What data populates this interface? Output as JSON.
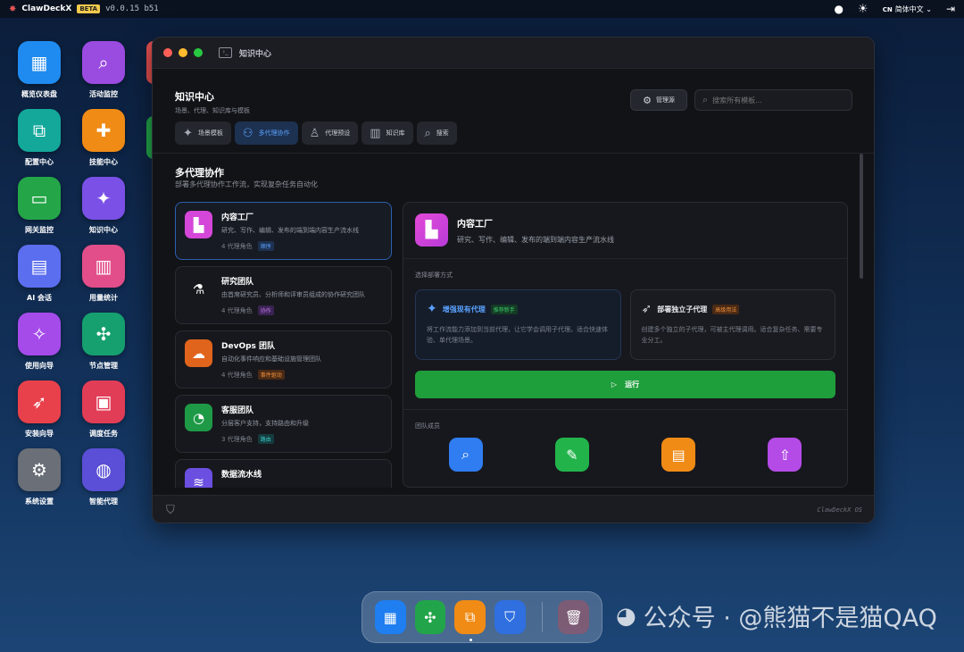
{
  "topbar": {
    "app_name": "ClawDeckX",
    "beta": "BETA",
    "version": "v0.0.15 b51",
    "lang_code": "CN",
    "lang_name": "简体中文"
  },
  "desktop_icons": [
    {
      "label": "概览仪表盘",
      "icon": "dashboard-icon",
      "color": "#1f8bf0",
      "glyph": "▦"
    },
    {
      "label": "活动监控",
      "icon": "activity-icon",
      "color": "#9a4be0",
      "glyph": "⌕"
    },
    {
      "label": "配置中心",
      "icon": "config-icon",
      "color": "#13a89a",
      "glyph": "⧉"
    },
    {
      "label": "技能中心",
      "icon": "puzzle-icon",
      "color": "#f08b16",
      "glyph": "✚"
    },
    {
      "label": "网关监控",
      "icon": "router-icon",
      "color": "#24a648",
      "glyph": "▭"
    },
    {
      "label": "知识中心",
      "icon": "sparkles-icon",
      "color": "#7b50e6",
      "glyph": "✦"
    },
    {
      "label": "AI 会话",
      "icon": "chat-icon",
      "color": "#5b6ef0",
      "glyph": "▤"
    },
    {
      "label": "用量统计",
      "icon": "stats-icon",
      "color": "#e24e8a",
      "glyph": "▥"
    },
    {
      "label": "使用向导",
      "icon": "wand-icon",
      "color": "#a44bea",
      "glyph": "✧"
    },
    {
      "label": "节点管理",
      "icon": "nodes-icon",
      "color": "#16a070",
      "glyph": "✣"
    },
    {
      "label": "安装向导",
      "icon": "rocket-icon",
      "color": "#e9414b",
      "glyph": "➶"
    },
    {
      "label": "调度任务",
      "icon": "calendar-icon",
      "color": "#e23d57",
      "glyph": "▣"
    },
    {
      "label": "系统设置",
      "icon": "gear-icon",
      "color": "#6a6f78",
      "glyph": "⚙"
    },
    {
      "label": "智能代理",
      "icon": "robot-icon",
      "color": "#5a4fd6",
      "glyph": "◍"
    }
  ],
  "window": {
    "title": "知识中心",
    "header_title": "知识中心",
    "header_sub": "场景、代理、知识库与模板",
    "manage_label": "管理源",
    "search_placeholder": "搜索所有模板...",
    "tabs": [
      {
        "label": "场景模板",
        "icon": "sparkles-icon",
        "glyph": "✦"
      },
      {
        "label": "多代理协作",
        "icon": "users-icon",
        "glyph": "⚇"
      },
      {
        "label": "代理预设",
        "icon": "user-icon",
        "glyph": "♙"
      },
      {
        "label": "知识库",
        "icon": "book-icon",
        "glyph": "▥"
      },
      {
        "label": "搜索",
        "icon": "search-icon",
        "glyph": "⌕"
      }
    ],
    "section_title": "多代理协作",
    "section_sub": "部署多代理协作工作流，实现复杂任务自动化",
    "workflows": [
      {
        "name": "内容工厂",
        "desc": "研究、写作、编辑、发布的端到端内容生产流水线",
        "meta": "4 代理角色",
        "badge": "顺序",
        "icon": "factory-icon",
        "glyph": "▙",
        "color": "#d447d8",
        "badge_bg": "#1d3150",
        "badge_fg": "#5aa2ff"
      },
      {
        "name": "研究团队",
        "desc": "由首席研究员、分析师和评审员组成的协作研究团队",
        "meta": "4 代理角色",
        "badge": "协作",
        "icon": "microscope-icon",
        "glyph": "⚗",
        "color": "#17181d",
        "badge_bg": "#3a2352",
        "badge_fg": "#c47bf0"
      },
      {
        "name": "DevOps 团队",
        "desc": "自动化事件响应和基础设施管理团队",
        "meta": "4 代理角色",
        "badge": "事件驱动",
        "icon": "cloud-icon",
        "glyph": "☁",
        "color": "#e0641c",
        "badge_bg": "#4a2a15",
        "badge_fg": "#f0913c"
      },
      {
        "name": "客服团队",
        "desc": "分层客户支持，支持路由和升级",
        "meta": "3 代理角色",
        "badge": "路由",
        "icon": "headset-icon",
        "glyph": "◔",
        "color": "#1e9a47",
        "badge_bg": "#143b3e",
        "badge_fg": "#3cc7c4"
      },
      {
        "name": "数据流水线",
        "desc": "",
        "meta": "",
        "badge": "",
        "icon": "data-icon",
        "glyph": "≋",
        "color": "#6a4fe0",
        "badge_bg": "",
        "badge_fg": ""
      }
    ],
    "detail": {
      "name": "内容工厂",
      "desc": "研究、写作、编辑、发布的端到端内容生产流水线",
      "deploy_label": "选择部署方式",
      "mode1_name": "增强现有代理",
      "mode1_badge": "推荐新手",
      "mode1_desc": "将工作流能力添加到当前代理，让它学会调用子代理。适合快速体验、单代理场景。",
      "mode2_name": "部署独立子代理",
      "mode2_badge": "高级用法",
      "mode2_desc": "创建多个独立的子代理，可被主代理调用。适合复杂任务、需要专业分工。",
      "run_label": "运行",
      "members_label": "团队成员",
      "members": [
        {
          "icon": "search-icon",
          "glyph": "⌕",
          "color": "#2f7df0"
        },
        {
          "icon": "pencil-icon",
          "glyph": "✎",
          "color": "#22b44b"
        },
        {
          "icon": "editor-icon",
          "glyph": "▤",
          "color": "#f08b16"
        },
        {
          "icon": "publish-icon",
          "glyph": "⇧",
          "color": "#b44be6"
        }
      ]
    },
    "footer_brand": "ClawDeckX OS"
  },
  "dock": [
    {
      "icon": "dashboard-icon",
      "glyph": "▦",
      "color": "#1f7ef0"
    },
    {
      "icon": "nodes-icon",
      "glyph": "✣",
      "color": "#22a54a"
    },
    {
      "icon": "config-icon",
      "glyph": "⧉",
      "color": "#f08b16"
    },
    {
      "icon": "shield-icon",
      "glyph": "⛉",
      "color": "#2f6fe0"
    },
    {
      "icon": "trash-icon",
      "glyph": "🗑",
      "color": "rgba(220,70,70,.35)"
    }
  ],
  "watermark": "公众号 · @熊猫不是猫QAQ"
}
